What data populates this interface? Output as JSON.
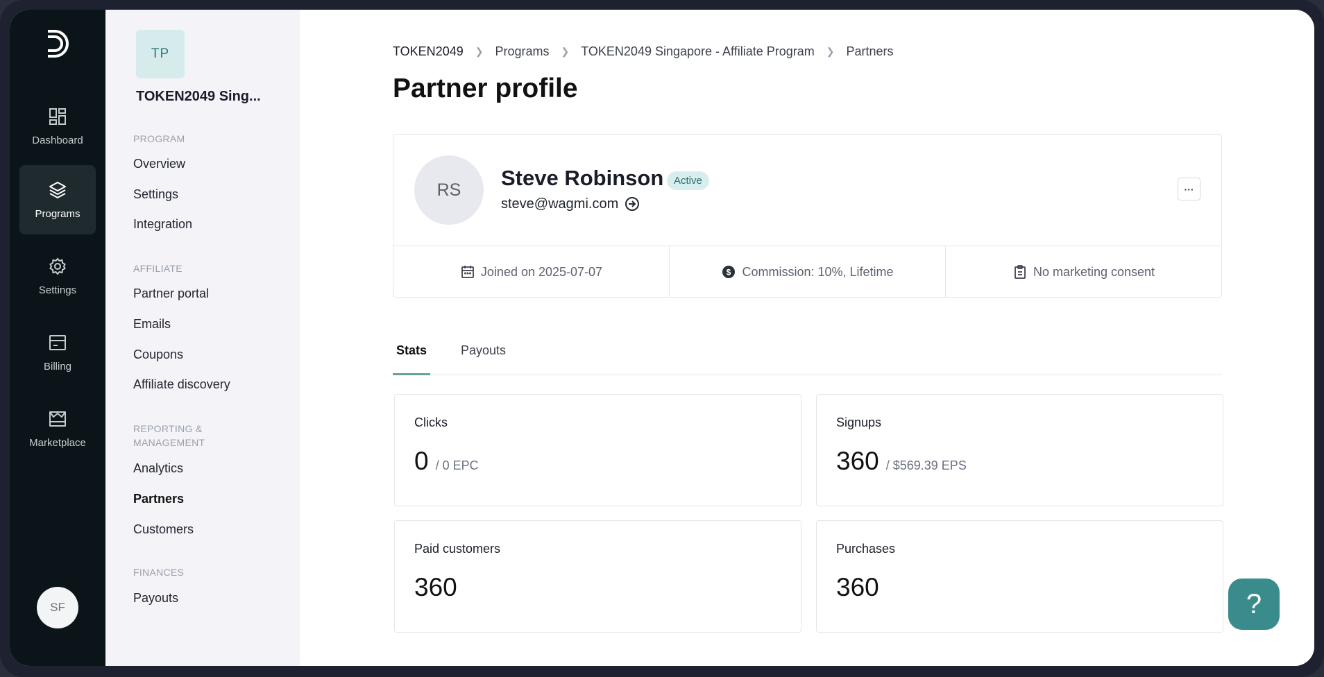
{
  "rail": {
    "items": [
      {
        "label": "Dashboard",
        "icon": "dashboard-icon"
      },
      {
        "label": "Programs",
        "icon": "layers-icon"
      },
      {
        "label": "Settings",
        "icon": "gear-icon"
      },
      {
        "label": "Billing",
        "icon": "billing-icon"
      },
      {
        "label": "Marketplace",
        "icon": "store-icon"
      }
    ],
    "avatar": "SF"
  },
  "sidebar": {
    "tile": "TP",
    "program_name": "TOKEN2049 Sing...",
    "sections": [
      {
        "title": "PROGRAM",
        "links": [
          "Overview",
          "Settings",
          "Integration"
        ]
      },
      {
        "title": "AFFILIATE",
        "links": [
          "Partner portal",
          "Emails",
          "Coupons",
          "Affiliate discovery"
        ]
      },
      {
        "title": "REPORTING & MANAGEMENT",
        "links": [
          "Analytics",
          "Partners",
          "Customers"
        ]
      },
      {
        "title": "FINANCES",
        "links": [
          "Payouts"
        ]
      }
    ]
  },
  "breadcrumb": [
    "TOKEN2049",
    "Programs",
    "TOKEN2049 Singapore - Affiliate Program",
    "Partners"
  ],
  "page_title": "Partner profile",
  "profile": {
    "initials": "RS",
    "name": "Steve Robinson",
    "status": "Active",
    "email": "steve@wagmi.com",
    "more": "···",
    "joined": "Joined on 2025-07-07",
    "commission": "Commission: 10%, Lifetime",
    "consent": "No marketing consent"
  },
  "tabs": [
    "Stats",
    "Payouts"
  ],
  "stats": {
    "clicks": {
      "label": "Clicks",
      "value": "0",
      "sub": "/ 0 EPC"
    },
    "signups": {
      "label": "Signups",
      "value": "360",
      "sub": "/ $569.39 EPS"
    },
    "paid": {
      "label": "Paid customers",
      "value": "360"
    },
    "purchases": {
      "label": "Purchases",
      "value": "360"
    }
  },
  "help": "?",
  "colors": {
    "accent": "#3a8c8c",
    "rail": "#0b1418",
    "sidebar": "#f3f3f8"
  }
}
